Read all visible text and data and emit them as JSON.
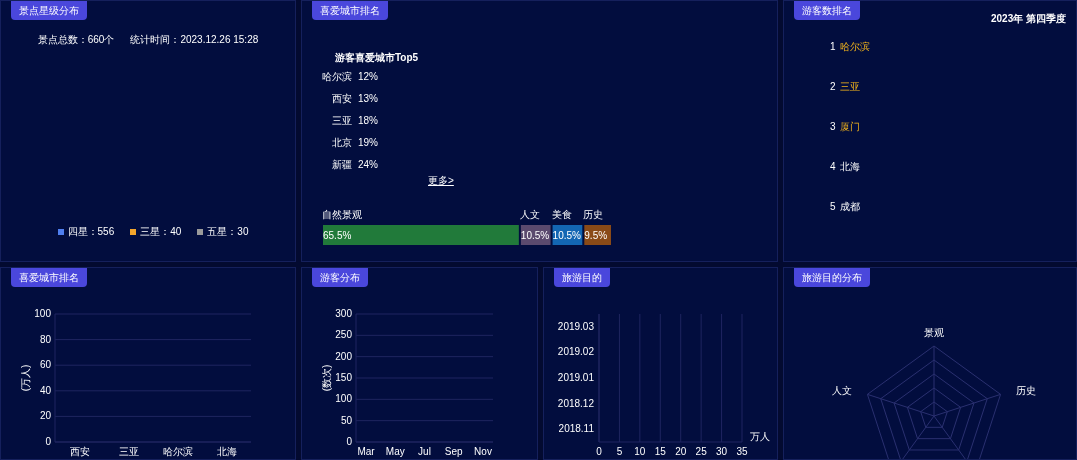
{
  "star_panel": {
    "tab": "景点星级分布",
    "total": "景点总数：660个",
    "time": "统计时间：2023.12.26 15:28",
    "legend": [
      {
        "label": "四星：556",
        "color": "#4f7ff0"
      },
      {
        "label": "三星：40",
        "color": "#f3a52c"
      },
      {
        "label": "五星：30",
        "color": "#9a9a9a"
      }
    ]
  },
  "city_panel": {
    "tab": "喜爱城市排名",
    "list_title": "游客喜爱城市Top5",
    "rows": [
      {
        "city": "哈尔滨",
        "percent": "12%"
      },
      {
        "city": "西安",
        "percent": "13%"
      },
      {
        "city": "三亚",
        "percent": "18%"
      },
      {
        "city": "北京",
        "percent": "19%"
      },
      {
        "city": "新疆",
        "percent": "24%"
      }
    ],
    "more_link": "更多>",
    "share_chart": {
      "chart_data": {
        "type": "bar",
        "orientation": "horizontal",
        "stacked": true,
        "series": [
          {
            "name": "自然景观",
            "color": "#217a3a",
            "values": [
              65.5
            ],
            "value_labels": [
              "65.5%"
            ]
          },
          {
            "name": "人文",
            "color": "#5b4a6e",
            "values": [
              10.5
            ],
            "value_labels": [
              "10.5%"
            ]
          },
          {
            "name": "美食",
            "color": "#1366b3",
            "values": [
              10.5
            ],
            "value_labels": [
              "10.5%"
            ]
          },
          {
            "name": "历史",
            "color": "#8a4a17",
            "values": [
              9.5
            ],
            "value_labels": [
              "9.5%"
            ]
          }
        ]
      }
    }
  },
  "rank_panel": {
    "tab": "游客数排名",
    "period": "2023年 第四季度",
    "items": [
      {
        "rank": "1",
        "city": "哈尔滨",
        "highlighted": true
      },
      {
        "rank": "2",
        "city": "三亚",
        "highlighted": true
      },
      {
        "rank": "3",
        "city": "厦门",
        "highlighted": true
      },
      {
        "rank": "4",
        "city": "北海",
        "highlighted": false
      },
      {
        "rank": "5",
        "city": "成都",
        "highlighted": false
      }
    ]
  },
  "bottom_panels": [
    {
      "tab": "喜爱城市排名",
      "chart_data": {
        "type": "bar",
        "ylabel": "(万人)",
        "categories": [
          "西安",
          "三亚",
          "哈尔滨",
          "北海"
        ],
        "values": [
          null,
          null,
          null,
          null
        ],
        "grid": true,
        "yticks": [
          0,
          20,
          40,
          60,
          80,
          100
        ],
        "ylim": [
          0,
          100
        ]
      }
    },
    {
      "tab": "游客分布",
      "chart_data": {
        "type": "line",
        "ylabel": "(数次)",
        "categories": [
          "Mar",
          "May",
          "Jul",
          "Sep",
          "Nov"
        ],
        "values": [
          null,
          null,
          null,
          null,
          null
        ],
        "grid": true,
        "yticks": [
          0,
          50,
          100,
          150,
          200,
          250,
          300
        ],
        "ylim": [
          0,
          300
        ]
      }
    },
    {
      "tab": "旅游目的",
      "chart_data": {
        "type": "bar",
        "orientation": "horizontal",
        "xlabel": "万人",
        "categories": [
          "2019.03",
          "2019.02",
          "2019.01",
          "2018.12",
          "2018.11"
        ],
        "values": [
          null,
          null,
          null,
          null,
          null
        ],
        "grid": true,
        "xticks": [
          0,
          5,
          10,
          15,
          20,
          25,
          30,
          35
        ],
        "xlim": [
          0,
          35
        ]
      }
    },
    {
      "tab": "旅游目的分布",
      "radar_labels": [
        "景观",
        "历史",
        "人文"
      ]
    }
  ]
}
